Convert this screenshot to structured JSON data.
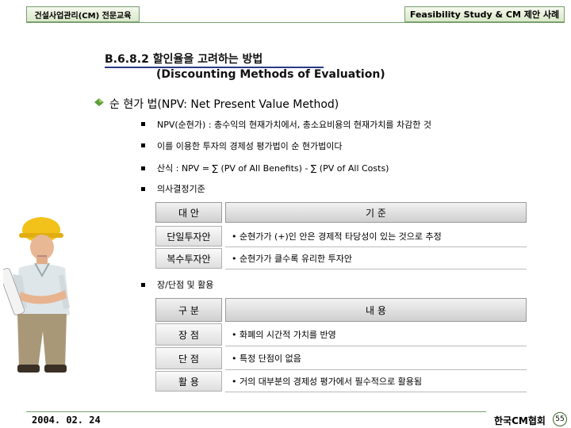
{
  "header": {
    "left_tab": "건설사업관리(CM) 전문교육",
    "right_tab": "Feasibility Study & CM 제안 사례"
  },
  "section": {
    "title": "B.6.8.2 할인율을 고려하는 방법",
    "subtitle": "(Discounting Methods of Evaluation)"
  },
  "npv": {
    "heading": "순 현가 법(NPV: Net Present Value Method)",
    "bullets": [
      "NPV(순현가) : 총수익의 현재가치에서, 총소요비용의 현재가치를 차감한 것",
      "이를 이용한 투자의 경제성 평가법이 순 현가법이다",
      "산식 : NPV = ∑ (PV of All Benefits) - ∑ (PV of All Costs)",
      "의사결정기준"
    ]
  },
  "criteria_table": {
    "headers": [
      "대    안",
      "기          준"
    ],
    "rows": [
      {
        "label": "단일투자안",
        "value": "• 순현가가 (+)인 안은 경제적 타당성이 있는 것으로 추정"
      },
      {
        "label": "복수투자안",
        "value": "• 순현가가 클수록 유리한 투자안"
      }
    ]
  },
  "usage": {
    "bullet": "장/단점 및 활용"
  },
  "usage_table": {
    "headers": [
      "구    분",
      "내          용"
    ],
    "rows": [
      {
        "label": "장    점",
        "value": "• 화폐의 시간적 가치를 반영"
      },
      {
        "label": "단    점",
        "value": "• 특정 단점이 없음"
      },
      {
        "label": "활    용",
        "value": "• 거의 대부분의 경제성 평가에서 필수적으로 활용됨"
      }
    ]
  },
  "footer": {
    "date": "2004. 02. 24",
    "org": "한국CM협회",
    "page": "55"
  },
  "icons": {
    "person": "construction-worker-icon",
    "bullet_diamond": "green-diamond-bullet-icon"
  },
  "colors": {
    "accent_green": "#7aa070",
    "title_underline": "#2a3b86",
    "helmet": "#f2c21a"
  }
}
